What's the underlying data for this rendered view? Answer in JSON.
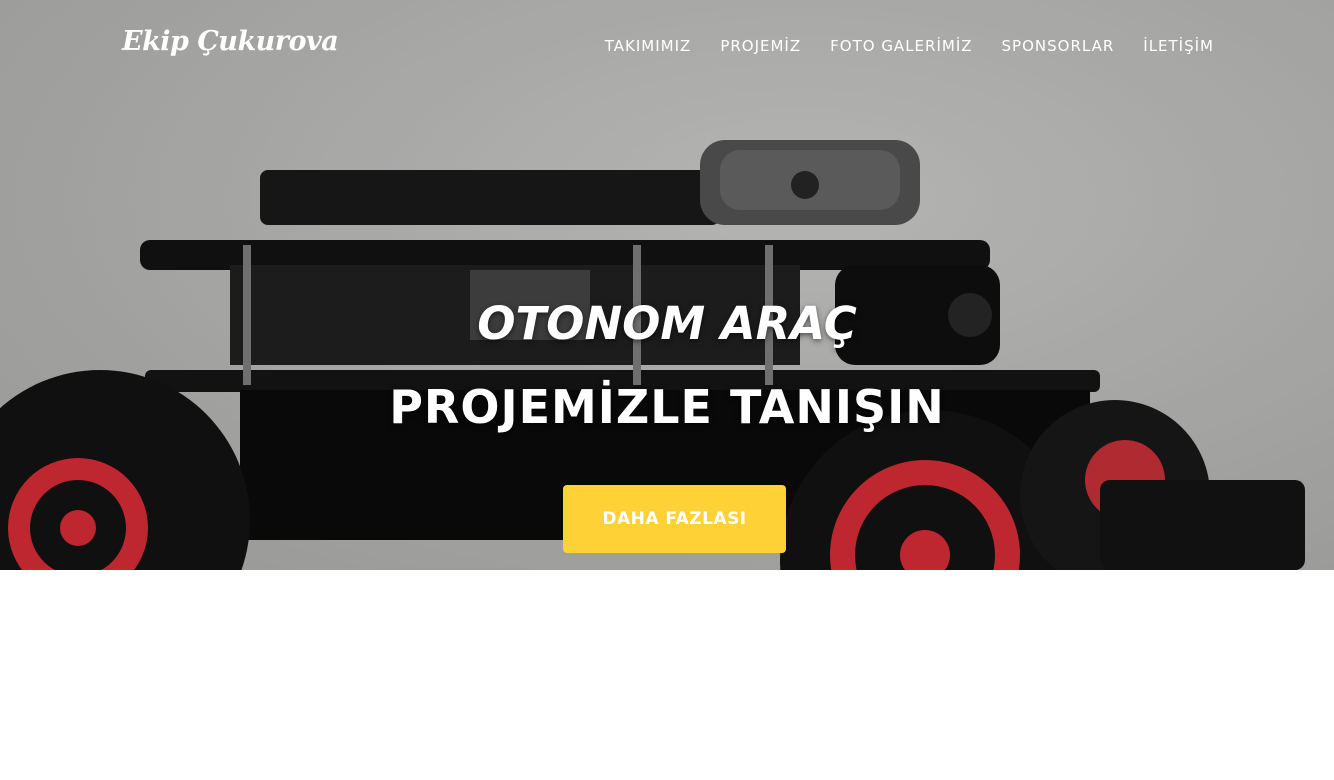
{
  "brand": {
    "name": "Ekip Çukurova"
  },
  "nav": {
    "items": [
      {
        "label": "TAKIMIMIZ"
      },
      {
        "label": "PROJEMİZ"
      },
      {
        "label": "FOTO GALERİMİZ"
      },
      {
        "label": "SPONSORLAR"
      },
      {
        "label": "İLETİŞİM"
      }
    ]
  },
  "hero": {
    "subheading": "OTONOM ARAÇ",
    "heading": "PROJEMİZLE TANIŞIN",
    "cta_label": "DAHA FAZLASI",
    "background_image": "autonomous-robot-car-photo"
  },
  "colors": {
    "accent": "#fed136",
    "hero_text": "#ffffff",
    "wheel_rim": "#e8303a",
    "page_background": "#ffffff"
  }
}
